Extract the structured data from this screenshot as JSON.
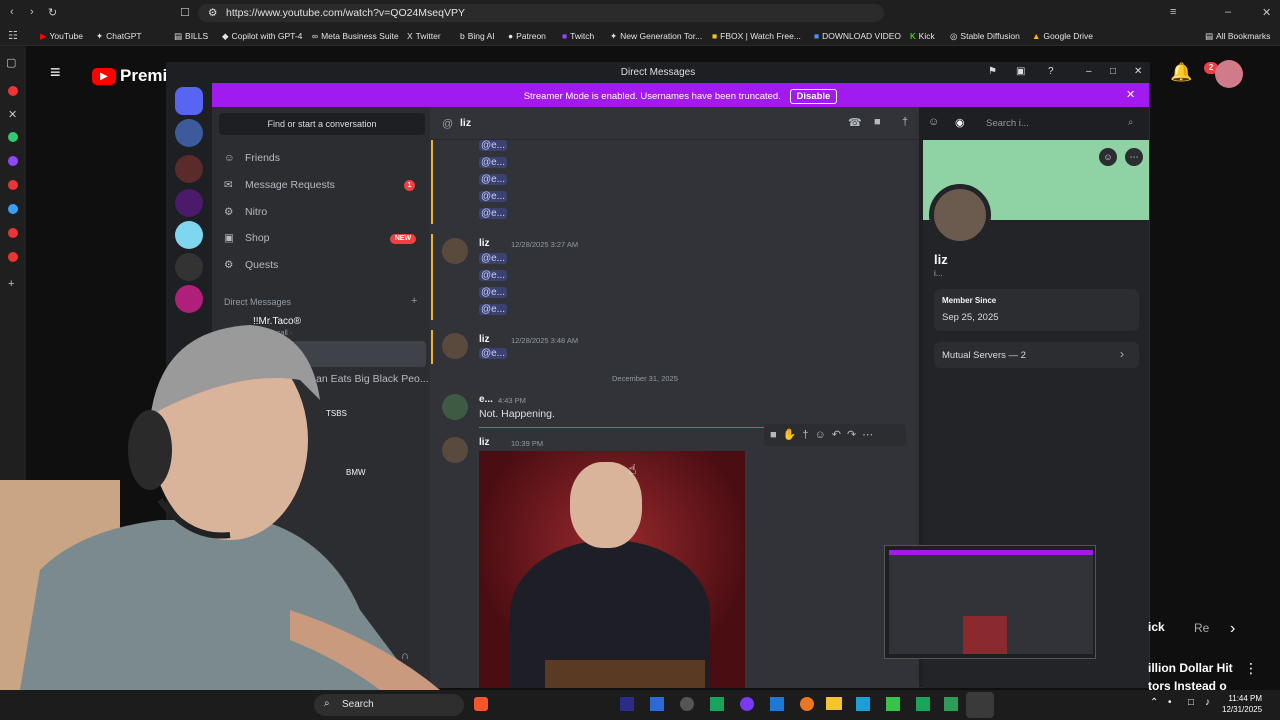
{
  "browser": {
    "url": "https://www.youtube.com/watch?v=QO24MseqVPY",
    "bookmarks": [
      "YouTube",
      "ChatGPT",
      "BILLS",
      "Copilot with GPT-4",
      "Meta Business Suite",
      "Twitter",
      "Bing AI",
      "Patreon",
      "Twitch",
      "New Generation Tor...",
      "FBOX | Watch Free...",
      "DOWNLOAD VIDEO",
      "Kick",
      "Stable Diffusion",
      "Google Drive",
      "All Bookmarks"
    ]
  },
  "youtube": {
    "logo_text": "Premiu",
    "notif_count": "2",
    "right_chip_1": "ick",
    "right_chip_2": "Re",
    "video_title_1": "illion Dollar Hit",
    "video_title_2": "tors Instead o"
  },
  "discord": {
    "window_title": "Direct Messages",
    "banner_text": "Streamer Mode is enabled. Usernames have been truncated.",
    "banner_button": "Disable",
    "find_placeholder": "Find or start a conversation",
    "nav": [
      {
        "label": "Friends",
        "icon": "friends-icon"
      },
      {
        "label": "Message Requests",
        "icon": "mail-icon",
        "badge": "1"
      },
      {
        "label": "Nitro",
        "icon": "nitro-icon"
      },
      {
        "label": "Shop",
        "icon": "shop-icon",
        "badge": "NEW"
      },
      {
        "label": "Quests",
        "icon": "quests-icon"
      }
    ],
    "dm_section_label": "Direct Messages",
    "dms": [
      {
        "name": "!!Mr.Taco®",
        "sub": "In a call ·"
      },
      {
        "name": "an Eats Big Black Peo...",
        "sub": ""
      },
      {
        "name": "TSBS",
        "sub": ""
      },
      {
        "name": "BMW",
        "sub": ""
      }
    ],
    "chat_user": "liz",
    "search_placeholder": "Search i...",
    "messages": [
      {
        "author": "liz",
        "time": "12/28/2025 3:27 AM",
        "mentions": [
          "@e...",
          "@e...",
          "@e...",
          "@e..."
        ]
      },
      {
        "author": "liz",
        "time": "12/28/2025 3:48 AM",
        "mentions": [
          "@e..."
        ]
      }
    ],
    "top_mentions": [
      "@e...",
      "@e...",
      "@e...",
      "@e...",
      "@e..."
    ],
    "date_divider": "December 31, 2025",
    "msg3": {
      "author": "e...",
      "time": "4:43 PM",
      "text": "Not. Happening."
    },
    "msg4": {
      "author": "liz",
      "time": "10:39 PM"
    },
    "profile": {
      "name": "liz",
      "sub": "i...",
      "member_since_label": "Member Since",
      "member_since": "Sep 25, 2025",
      "mutual_servers": "Mutual Servers — 2"
    }
  },
  "taskbar": {
    "search": "Search",
    "time": "11:44 PM",
    "date": "12/31/2025"
  }
}
